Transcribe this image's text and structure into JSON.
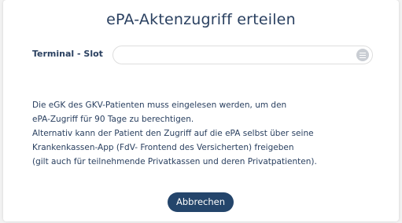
{
  "dialog": {
    "title": "ePA-Aktenzugriff erteilen",
    "terminal_slot": {
      "label": "Terminal - Slot",
      "value": "",
      "icon": "menu-icon"
    },
    "message_lines": [
      "Die eGK des GKV-Patienten muss eingelesen werden, um den",
      "ePA-Zugriff für 90 Tage zu berechtigen.",
      "Alternativ kann der Patient den Zugriff auf die ePA selbst über seine",
      "Krankenkassen-App (FdV- Frontend des Versicherten) freigeben",
      "(gilt auch für teilnehmende Privatkassen und deren Privatpatienten)."
    ],
    "cancel_label": "Abbrechen"
  },
  "colors": {
    "title_text": "#2a4060",
    "button_bg": "#24456b",
    "button_text": "#ffffff",
    "field_border": "#dedede",
    "icon_bg": "#c9cdd3"
  }
}
